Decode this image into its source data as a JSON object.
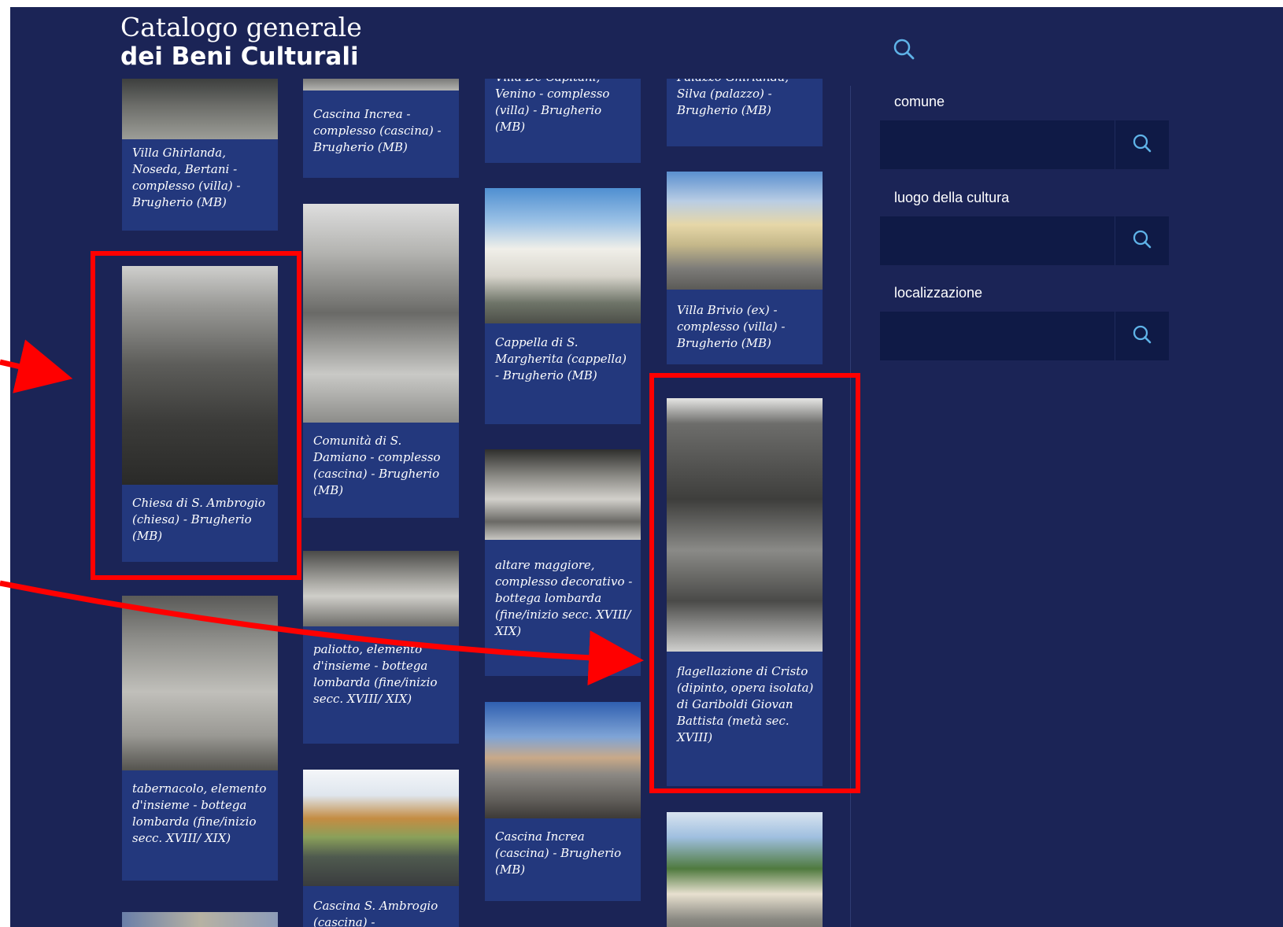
{
  "header": {
    "logo_line1": "Catalogo generale",
    "logo_line2": "dei Beni Culturali",
    "search_icon": "search-icon"
  },
  "results": [
    {
      "caption": "Villa Ghirlanda, Noseda, Bertani - complesso (villa) - Brugherio (MB)"
    },
    {
      "caption": "Chiesa di S. Ambrogio (chiesa) - Brugherio (MB)"
    },
    {
      "caption": "tabernacolo, elemento d'insieme - bottega lombarda (fine/inizio secc. XVIII/ XIX)"
    },
    {
      "caption": "Cascina Increa - complesso (cascina) - Brugherio (MB)"
    },
    {
      "caption": "Comunità di S. Damiano - complesso (cascina) - Brugherio (MB)"
    },
    {
      "caption": "paliotto, elemento d'insieme - bottega lombarda (fine/inizio secc. XVIII/ XIX)"
    },
    {
      "caption": "Cascina S. Ambrogio (cascina) -"
    },
    {
      "caption": "Villa De Capitani, Venino - complesso (villa) - Brugherio (MB)"
    },
    {
      "caption": "Cappella di S. Margherita (cappella) - Brugherio (MB)"
    },
    {
      "caption": "altare maggiore, complesso decorativo - bottega lombarda (fine/inizio secc. XVIII/ XIX)"
    },
    {
      "caption": "Cascina Increa (cascina) - Brugherio (MB)"
    },
    {
      "caption": "Palazzo Ghirlanda, Silva (palazzo) - Brugherio (MB)"
    },
    {
      "caption": "Villa Brivio (ex) - complesso (villa) - Brugherio (MB)"
    },
    {
      "caption": "flagellazione di Cristo (dipinto, opera isolata) di Gariboldi Giovan Battista (metà sec. XVIII)"
    }
  ],
  "filters": [
    {
      "label": "comune",
      "value": ""
    },
    {
      "label": "luogo della cultura",
      "value": ""
    },
    {
      "label": "localizzazione",
      "value": ""
    }
  ],
  "colors": {
    "page_bg": "#1b2456",
    "card_bg": "#23387d",
    "field_bg": "#0f1a46",
    "icon": "#5fb3e8",
    "annotation_red": "#ff0000"
  }
}
